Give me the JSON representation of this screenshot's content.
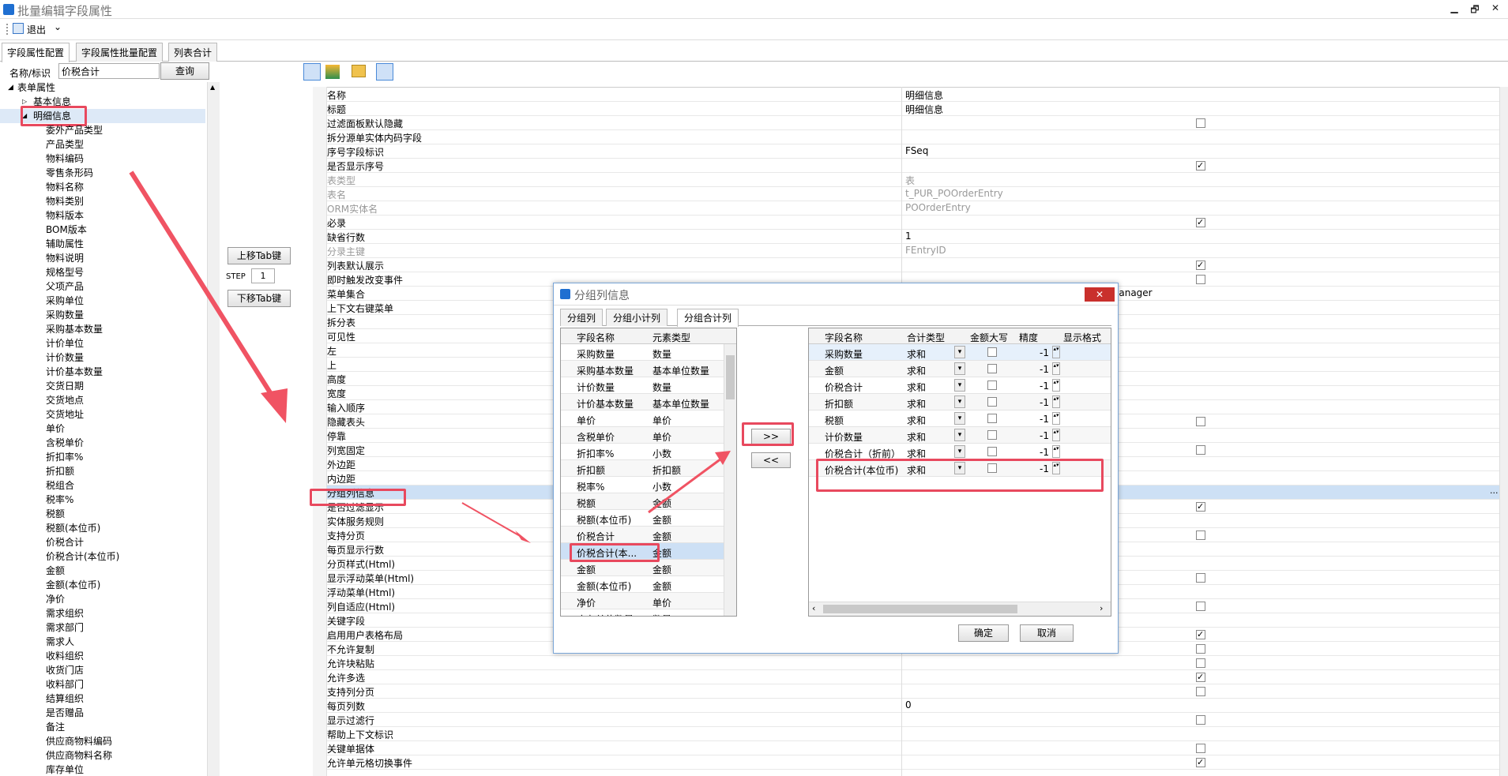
{
  "window": {
    "title": "批量编辑字段属性",
    "min": "▁",
    "restore": "🗗",
    "close": "✕"
  },
  "toolbar": {
    "exit": "退出",
    "dropdown": "⌄"
  },
  "tabs": [
    "字段属性配置",
    "字段属性批量配置",
    "列表合计"
  ],
  "search": {
    "label": "名称/标识",
    "value": "价税合计",
    "button": "查询"
  },
  "tree": {
    "root": "表单属性",
    "basic": "基本信息",
    "detail": "明细信息",
    "children": [
      "委外产品类型",
      "产品类型",
      "物料编码",
      "零售条形码",
      "物料名称",
      "物料类别",
      "物料版本",
      "BOM版本",
      "辅助属性",
      "物料说明",
      "规格型号",
      "父项产品",
      "采购单位",
      "采购数量",
      "采购基本数量",
      "计价单位",
      "计价数量",
      "计价基本数量",
      "交货日期",
      "交货地点",
      "交货地址",
      "单价",
      "含税单价",
      "折扣率%",
      "折扣额",
      "税组合",
      "税率%",
      "税额",
      "税额(本位币)",
      "价税合计",
      "价税合计(本位币)",
      "金额",
      "金额(本位币)",
      "净价",
      "需求组织",
      "需求部门",
      "需求人",
      "收料组织",
      "收货门店",
      "收料部门",
      "结算组织",
      "是否赠品",
      "备注",
      "供应商物料编码",
      "供应商物料名称",
      "库存单位"
    ]
  },
  "middle": {
    "up_tab": "上移Tab键",
    "step_label": "STEP",
    "step_value": "1",
    "down_tab": "下移Tab键"
  },
  "props": [
    {
      "n": "名称",
      "v": "明细信息",
      "chk": null
    },
    {
      "n": "标题",
      "v": "明细信息",
      "chk": null
    },
    {
      "n": "过滤面板默认隐藏",
      "v": "",
      "chk": false
    },
    {
      "n": "拆分源单实体内码字段",
      "v": "",
      "chk": null
    },
    {
      "n": "序号字段标识",
      "v": "FSeq",
      "chk": null
    },
    {
      "n": "是否显示序号",
      "v": "",
      "chk": true
    },
    {
      "n": "表类型",
      "v": "表",
      "chk": null,
      "grey": true
    },
    {
      "n": "表名",
      "v": "t_PUR_POOrderEntry",
      "chk": null,
      "grey": true
    },
    {
      "n": "ORM实体名",
      "v": "POOrderEntry",
      "chk": null,
      "grey": true
    },
    {
      "n": "必录",
      "v": "",
      "chk": true
    },
    {
      "n": "缺省行数",
      "v": "1",
      "chk": null
    },
    {
      "n": "分录主键",
      "v": "FEntryID",
      "chk": null,
      "grey": true
    },
    {
      "n": "列表默认展示",
      "v": "",
      "chk": true
    },
    {
      "n": "即时触发改变事件",
      "v": "",
      "chk": false
    },
    {
      "n": "菜单集合",
      "v": "",
      "chk": null,
      "tail": "Manager"
    },
    {
      "n": "上下文右键菜单",
      "v": "",
      "chk": null
    },
    {
      "n": "拆分表",
      "v": "",
      "chk": null
    },
    {
      "n": "可见性",
      "v": "",
      "chk": null
    },
    {
      "n": "左",
      "v": "",
      "chk": null
    },
    {
      "n": "上",
      "v": "",
      "chk": null
    },
    {
      "n": "高度",
      "v": "",
      "chk": null
    },
    {
      "n": "宽度",
      "v": "",
      "chk": null
    },
    {
      "n": "输入顺序",
      "v": "",
      "chk": null
    },
    {
      "n": "隐藏表头",
      "v": "",
      "chk": false
    },
    {
      "n": "停靠",
      "v": "",
      "chk": null
    },
    {
      "n": "列宽固定",
      "v": "",
      "chk": false
    },
    {
      "n": "外边距",
      "v": "",
      "chk": null
    },
    {
      "n": "内边距",
      "v": "",
      "chk": null
    },
    {
      "n": "分组列信息",
      "v": "",
      "chk": null,
      "sel": true,
      "ellipsis": "..."
    },
    {
      "n": "是否过滤显示",
      "v": "",
      "chk": true
    },
    {
      "n": "实体服务规则",
      "v": "",
      "chk": null
    },
    {
      "n": "支持分页",
      "v": "",
      "chk": false
    },
    {
      "n": "每页显示行数",
      "v": "",
      "chk": null
    },
    {
      "n": "分页样式(Html)",
      "v": "",
      "chk": null
    },
    {
      "n": "显示浮动菜单(Html)",
      "v": "",
      "chk": false
    },
    {
      "n": "浮动菜单(Html)",
      "v": "",
      "chk": null
    },
    {
      "n": "列自适应(Html)",
      "v": "",
      "chk": false
    },
    {
      "n": "关键字段",
      "v": "",
      "chk": null
    },
    {
      "n": "启用用户表格布局",
      "v": "",
      "chk": true
    },
    {
      "n": "不允许复制",
      "v": "",
      "chk": false
    },
    {
      "n": "允许块粘贴",
      "v": "",
      "chk": false
    },
    {
      "n": "允许多选",
      "v": "",
      "chk": true
    },
    {
      "n": "支持列分页",
      "v": "",
      "chk": false
    },
    {
      "n": "每页列数",
      "v": "0",
      "chk": null
    },
    {
      "n": "显示过滤行",
      "v": "",
      "chk": false
    },
    {
      "n": "帮助上下文标识",
      "v": "",
      "chk": null
    },
    {
      "n": "关键单据体",
      "v": "",
      "chk": false
    },
    {
      "n": "允许单元格切换事件",
      "v": "",
      "chk": true
    }
  ],
  "dialog": {
    "title": "分组列信息",
    "close": "✕",
    "tabs": [
      "分组列",
      "分组小计列",
      "分组合计列"
    ],
    "left_headers": [
      "字段名称",
      "元素类型"
    ],
    "left_rows": [
      [
        "采购数量",
        "数量"
      ],
      [
        "采购基本数量",
        "基本单位数量"
      ],
      [
        "计价数量",
        "数量"
      ],
      [
        "计价基本数量",
        "基本单位数量"
      ],
      [
        "单价",
        "单价"
      ],
      [
        "含税单价",
        "单价"
      ],
      [
        "折扣率%",
        "小数"
      ],
      [
        "折扣额",
        "折扣额"
      ],
      [
        "税率%",
        "小数"
      ],
      [
        "税额",
        "金额"
      ],
      [
        "税额(本位币)",
        "金额"
      ],
      [
        "价税合计",
        "金额"
      ],
      [
        "价税合计(本...",
        "金额"
      ],
      [
        "金额",
        "金额"
      ],
      [
        "金额(本位币)",
        "金额"
      ],
      [
        "净价",
        "单价"
      ],
      [
        "库存单位数量",
        "数量"
      ]
    ],
    "btn_add": ">>",
    "btn_remove": "<<",
    "right_headers": [
      "字段名称",
      "合计类型",
      "金额大写",
      "精度",
      "显示格式"
    ],
    "right_rows": [
      [
        "采购数量",
        "求和",
        "-1"
      ],
      [
        "金额",
        "求和",
        "-1"
      ],
      [
        "价税合计",
        "求和",
        "-1"
      ],
      [
        "折扣额",
        "求和",
        "-1"
      ],
      [
        "税额",
        "求和",
        "-1"
      ],
      [
        "计价数量",
        "求和",
        "-1"
      ],
      [
        "价税合计（折前）",
        "求和",
        "-1"
      ],
      [
        "价税合计(本位币)",
        "求和",
        "-1"
      ]
    ],
    "ok": "确定",
    "cancel": "取消"
  }
}
